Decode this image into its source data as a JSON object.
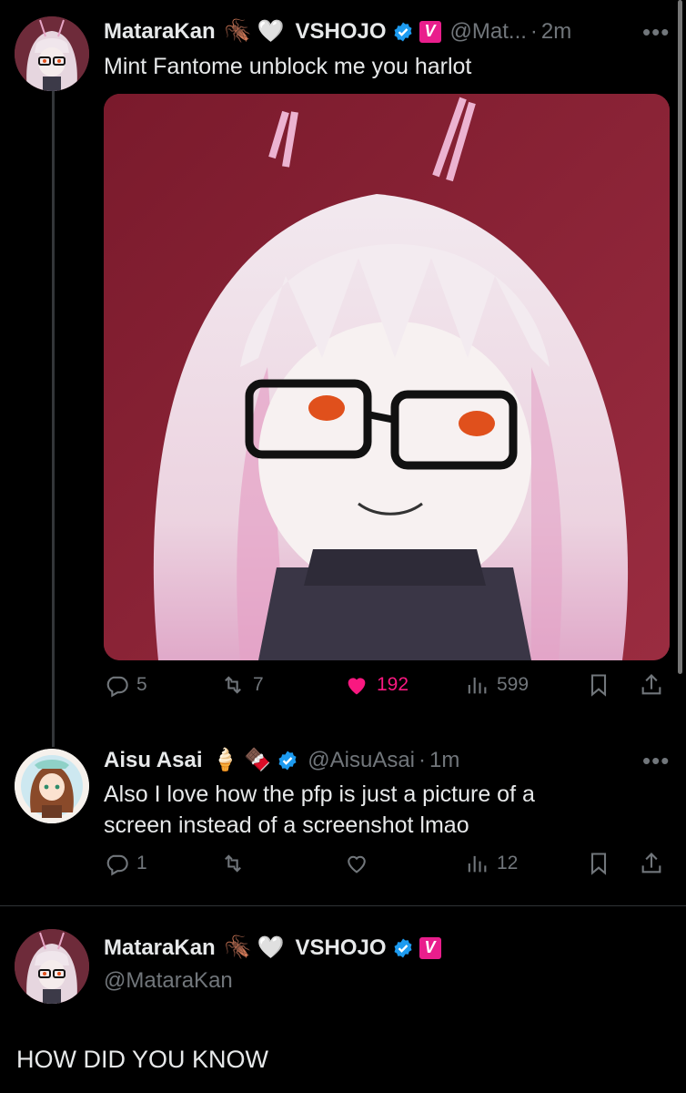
{
  "tweets": [
    {
      "name": "MataraKan",
      "emoji_1": "🪳",
      "emoji_2": "🤍",
      "affiliation": "VSHOJO",
      "badge_v": "V",
      "handle": "@Mat...",
      "time": "2m",
      "more": "•••",
      "text": "Mint Fantome unblock me you harlot",
      "replies": "5",
      "retweets": "7",
      "likes": "192",
      "views": "599"
    },
    {
      "name": "Aisu Asai",
      "emoji_1": "🍦",
      "emoji_2": "🍫",
      "handle": "@AisuAsai",
      "time": "1m",
      "more": "•••",
      "text_line1": "Also I love how the pfp is just a picture of a",
      "text_line2": "screen instead of a screenshot lmao",
      "replies": "1",
      "retweets": "",
      "likes": "",
      "views": "12"
    }
  ],
  "profile": {
    "name": "MataraKan",
    "emoji_1": "🪳",
    "emoji_2": "🤍",
    "affiliation": "VSHOJO",
    "badge_v": "V",
    "handle": "@MataraKan"
  },
  "caption": "HOW DID YOU KNOW",
  "colors": {
    "background": "#000000",
    "text": "#e7e9ea",
    "muted": "#71767b",
    "like_pink": "#f91880",
    "verified_blue": "#1d9bf0",
    "vshojo_pink": "#e91e8c"
  }
}
